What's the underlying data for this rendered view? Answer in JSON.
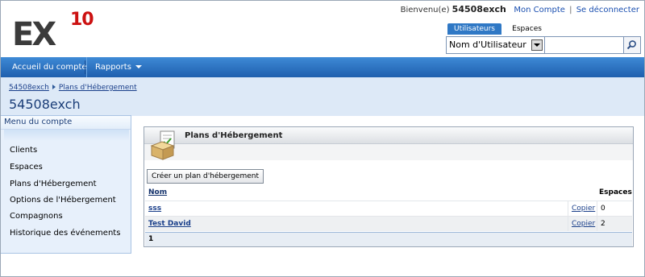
{
  "header": {
    "logo_text": "EX",
    "logo_sup": "10",
    "welcome_prefix": "Bienvenu(e)",
    "username": "54508exch",
    "my_account": "Mon Compte",
    "separator": "|",
    "logout": "Se déconnecter"
  },
  "search": {
    "tabs": [
      "Utilisateurs",
      "Espaces"
    ],
    "active_tab": "Utilisateurs",
    "select_value": "Nom d'Utilisateur",
    "input_value": "",
    "icon": "search-icon"
  },
  "nav": {
    "home": "Accueil du compte",
    "reports": "Rapports"
  },
  "breadcrumb": {
    "items": [
      "54508exch",
      "Plans d'Hébergement"
    ]
  },
  "page_title": "54508exch",
  "sidebar": {
    "title": "Menu du compte",
    "items": [
      "Clients",
      "Espaces",
      "Plans d'Hébergement",
      "Options de l'Hébergement",
      "Compagnons",
      "Historique des événements"
    ]
  },
  "panel": {
    "title": "Plans d'Hébergement",
    "create_button": "Créer un plan d'hébergement",
    "columns": {
      "name": "Nom",
      "spaces": "Espaces"
    },
    "rows": [
      {
        "name": "sss",
        "action": "Copier",
        "spaces": "0"
      },
      {
        "name": "Test David",
        "action": "Copier",
        "spaces": "2"
      }
    ],
    "pager": "1"
  },
  "colors": {
    "nav_bar": "#2f78c5",
    "title_band": "#dde9f7",
    "link": "#1a3f8a",
    "logo_red": "#cc1111"
  }
}
